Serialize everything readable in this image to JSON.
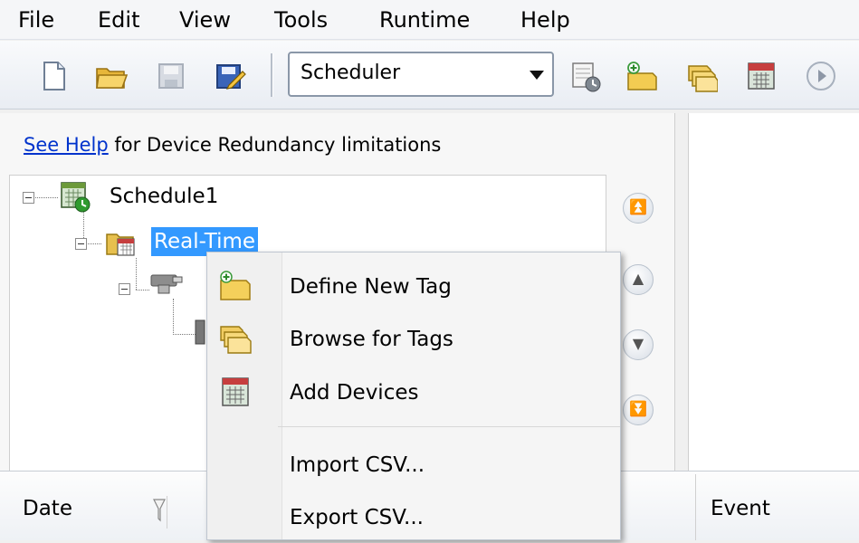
{
  "menubar": {
    "items": [
      "File",
      "Edit",
      "View",
      "Tools",
      "Runtime",
      "Help"
    ]
  },
  "toolbar": {
    "combo_value": "Scheduler",
    "icons": [
      "new-document-icon",
      "open-folder-icon",
      "save-icon",
      "save-as-icon",
      "schedule-icon",
      "define-tag-icon",
      "browse-tags-icon",
      "add-devices-icon",
      "play-icon"
    ]
  },
  "left": {
    "help_link": "See Help",
    "help_rest": " for Device Redundancy limitations",
    "tree": {
      "root": "Schedule1",
      "child": "Real-Time"
    }
  },
  "context_menu": {
    "items": [
      "Define New Tag",
      "Browse for Tags",
      "Add Devices",
      "Import CSV...",
      "Export CSV..."
    ]
  },
  "bottom": {
    "columns": [
      "Date",
      "Event"
    ]
  },
  "colors": {
    "selection": "#3399ff",
    "link": "#0033cc"
  }
}
